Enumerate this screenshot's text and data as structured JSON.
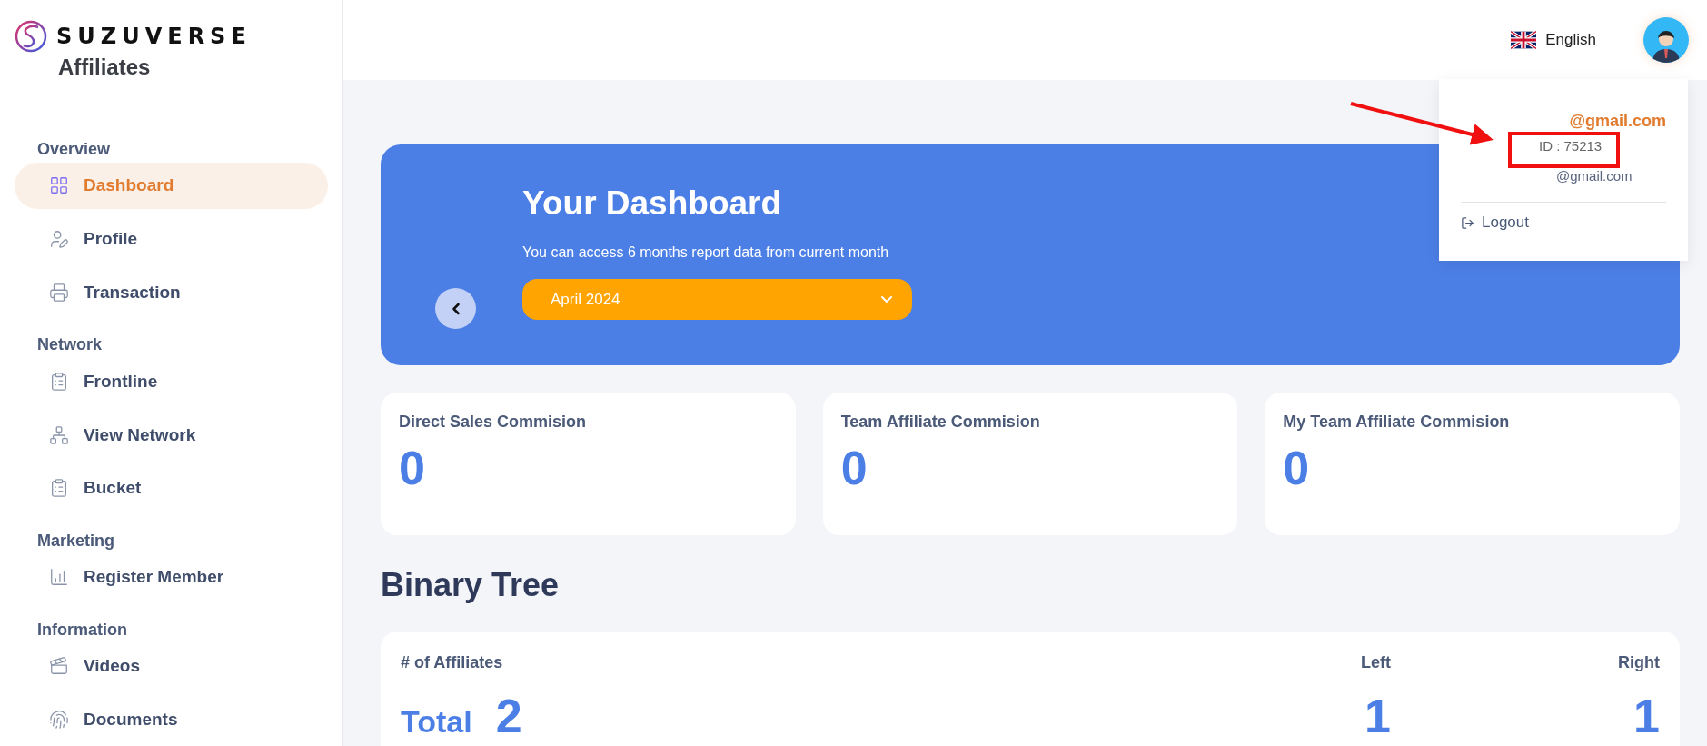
{
  "brand": {
    "name": "SUZUVERSE",
    "subtitle": "Affiliates"
  },
  "sidebar": {
    "sections": [
      {
        "title": "Overview",
        "items": [
          {
            "label": "Dashboard",
            "kind": "grid",
            "selected": true
          },
          {
            "label": "Profile",
            "kind": "profile",
            "selected": false
          },
          {
            "label": "Transaction",
            "kind": "printer",
            "selected": false
          }
        ]
      },
      {
        "title": "Network",
        "items": [
          {
            "label": "Frontline",
            "kind": "list",
            "selected": false
          },
          {
            "label": "View Network",
            "kind": "network",
            "selected": false
          },
          {
            "label": "Bucket",
            "kind": "list",
            "selected": false
          }
        ]
      },
      {
        "title": "Marketing",
        "items": [
          {
            "label": "Register Member",
            "kind": "chart",
            "selected": false
          }
        ]
      },
      {
        "title": "Information",
        "items": [
          {
            "label": "Videos",
            "kind": "video",
            "selected": false
          },
          {
            "label": "Documents",
            "kind": "fingerprint",
            "selected": false
          }
        ]
      }
    ]
  },
  "topbar": {
    "language": "English"
  },
  "user_menu": {
    "email_title": "@gmail.com",
    "id": "ID : 75213",
    "email": "@gmail.com",
    "logout": "Logout"
  },
  "banner": {
    "title": "Your Dashboard",
    "subtitle": "You can access 6 months report data from current month",
    "month": "April 2024"
  },
  "stats": [
    {
      "label": "Direct Sales Commision",
      "value": "0"
    },
    {
      "label": "Team Affiliate Commision",
      "value": "0"
    },
    {
      "label": "My Team Affiliate Commision",
      "value": "0"
    }
  ],
  "binary_tree": {
    "title": "Binary Tree",
    "header": "# of Affiliates",
    "total_label": "Total",
    "total": "2",
    "columns": [
      {
        "label": "Left",
        "value": "1"
      },
      {
        "label": "Right",
        "value": "1"
      }
    ]
  }
}
